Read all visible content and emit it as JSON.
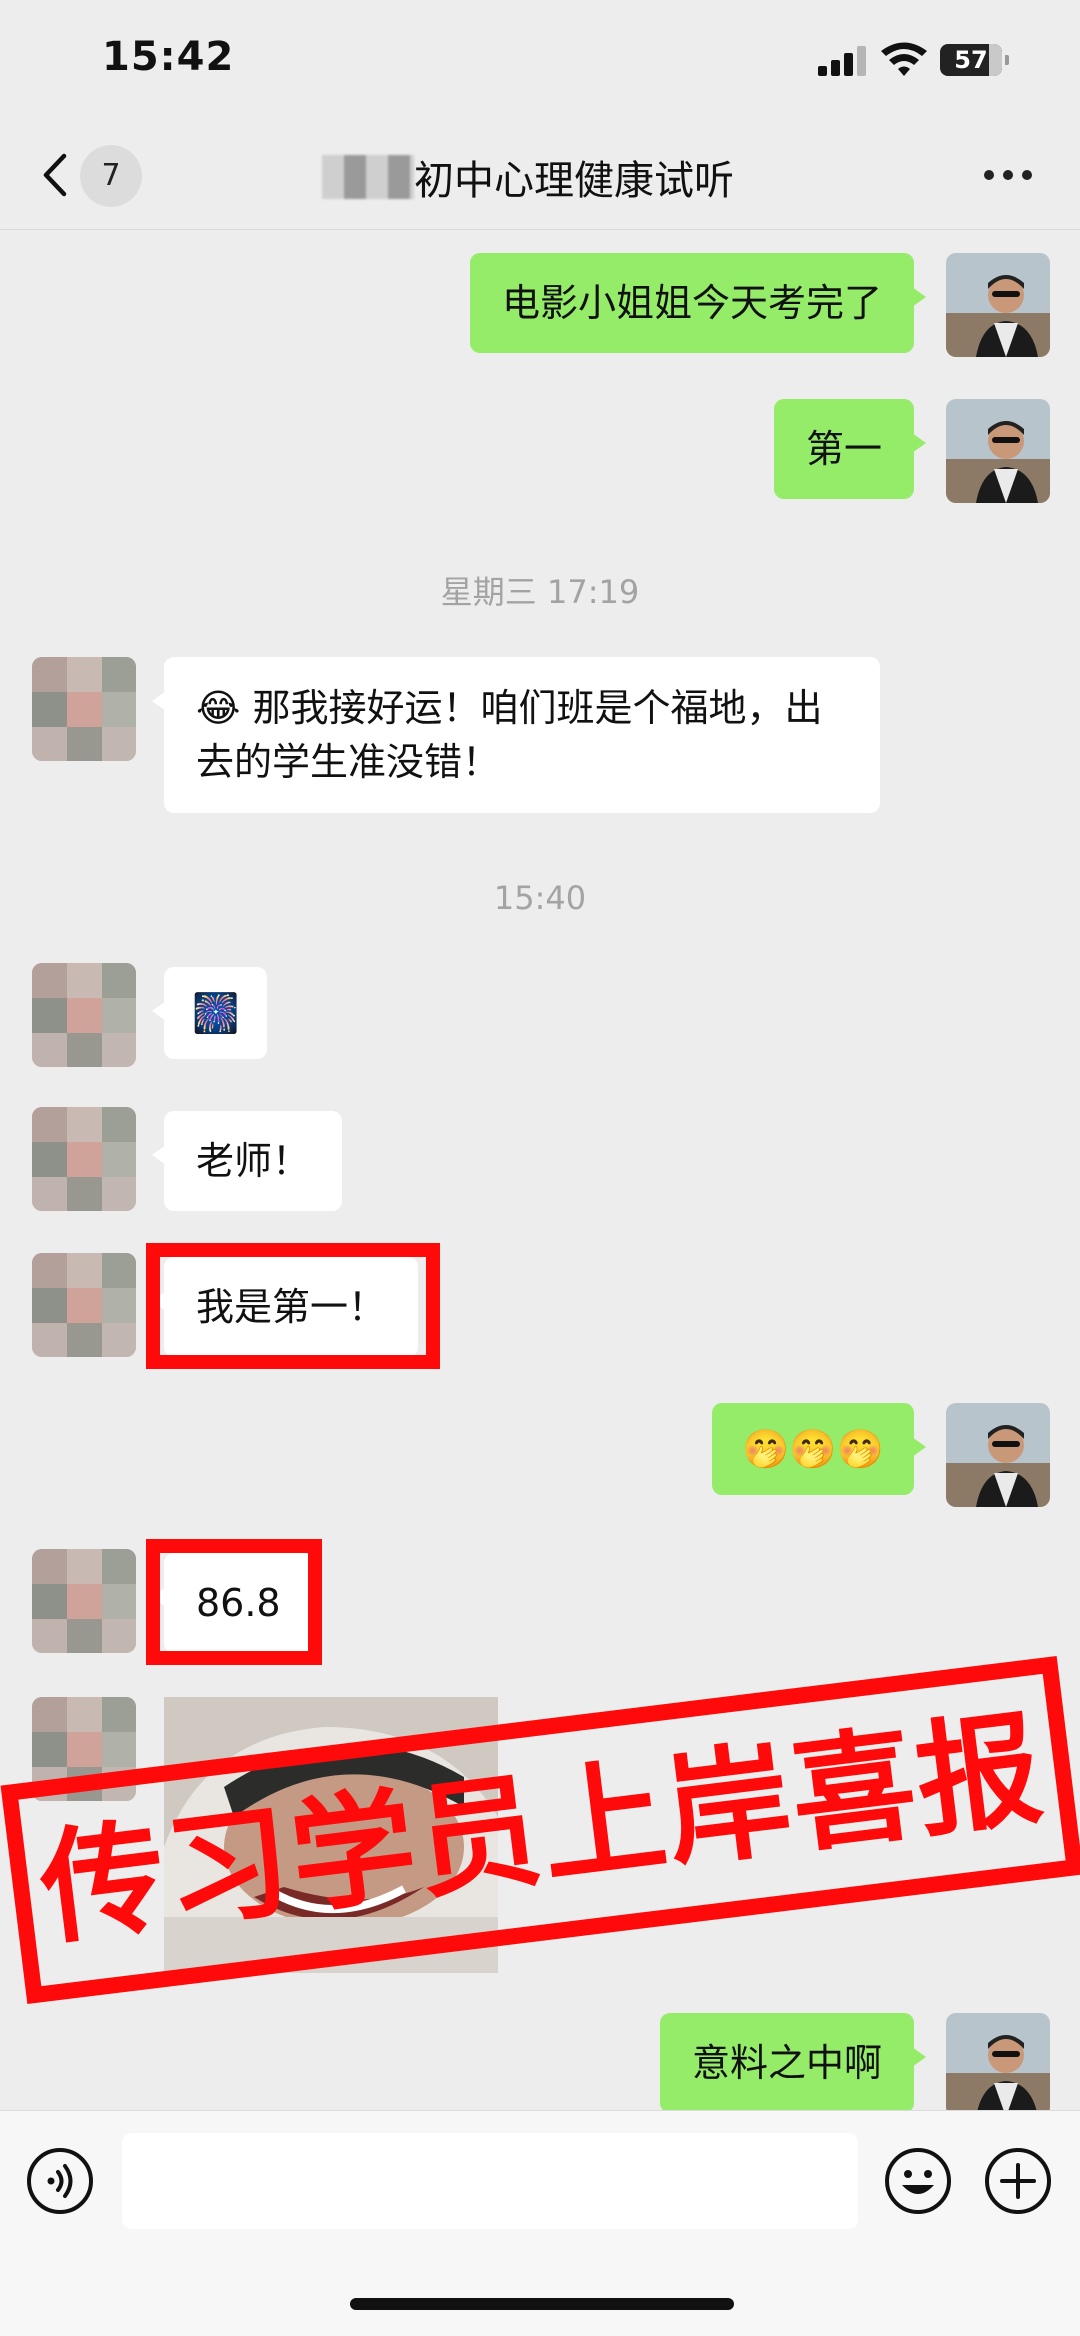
{
  "status_bar": {
    "time": "15:42",
    "battery": "57"
  },
  "nav": {
    "unread_count": "7",
    "title": "初中心理健康试听"
  },
  "messages": {
    "m1_me": "电影小姐姐今天考完了",
    "m2_me": "第一",
    "time1": "星期三 17:19",
    "m3_other": "那我接好运！咱们班是个福地，出去的学生准没错！",
    "m3_emoji": "😂",
    "time2": "15:40",
    "m4_other_emoji": "🎆",
    "m5_other": "老师！",
    "m6_other": "我是第一！",
    "m7_me_emoji": "🤭🤭🤭",
    "m8_other": "86.8",
    "m10_me": "意料之中啊"
  },
  "stamp": {
    "text": "传习学员上岸喜报"
  },
  "colors": {
    "bubble_me": "#95ec69",
    "bubble_other": "#ffffff",
    "highlight_red": "#ff0a0a",
    "background": "#ededed"
  },
  "icons": {
    "back": "chevron-left-icon",
    "more": "more-dots-icon",
    "voice": "voice-icon",
    "emoji": "emoji-face-icon",
    "plus": "plus-icon"
  }
}
